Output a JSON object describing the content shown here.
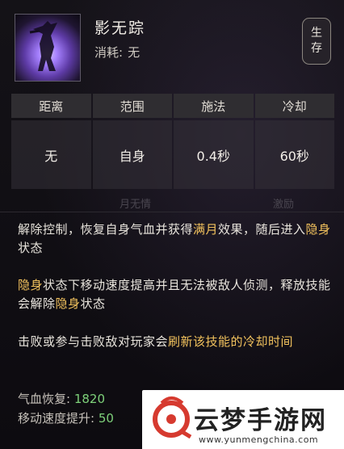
{
  "skill": {
    "name": "影无踪",
    "cost_label": "消耗:",
    "cost_value": "无",
    "tag": [
      "生",
      "存"
    ]
  },
  "stats": {
    "headers": [
      "距离",
      "范围",
      "施法",
      "冷却"
    ],
    "values": [
      "无",
      "自身",
      "0.4秒",
      "60秒"
    ]
  },
  "sub_tabs": [
    "月无情",
    "激励"
  ],
  "description": {
    "p1": [
      {
        "t": "解除控制，恢复自身气血并获得"
      },
      {
        "t": "满月",
        "h": true
      },
      {
        "t": "效果，随后进入"
      },
      {
        "t": "隐身",
        "h": true
      },
      {
        "t": "状态"
      }
    ],
    "p2": [
      {
        "t": "隐身",
        "h": true
      },
      {
        "t": "状态下移动速度提高并且无法被敌人侦测，释放技能会解除"
      },
      {
        "t": "隐身",
        "h": true
      },
      {
        "t": "状态"
      }
    ],
    "p3": [
      {
        "t": "击败或参与击败敌对玩家会"
      },
      {
        "t": "刷新该技能的冷却时间",
        "h": true
      }
    ]
  },
  "attributes": [
    {
      "label": "气血恢复:",
      "value": "1820"
    },
    {
      "label": "移动速度提升:",
      "value": "50"
    }
  ],
  "watermark": {
    "title": "云梦手游网",
    "url": "www.yunmengchina.com"
  }
}
